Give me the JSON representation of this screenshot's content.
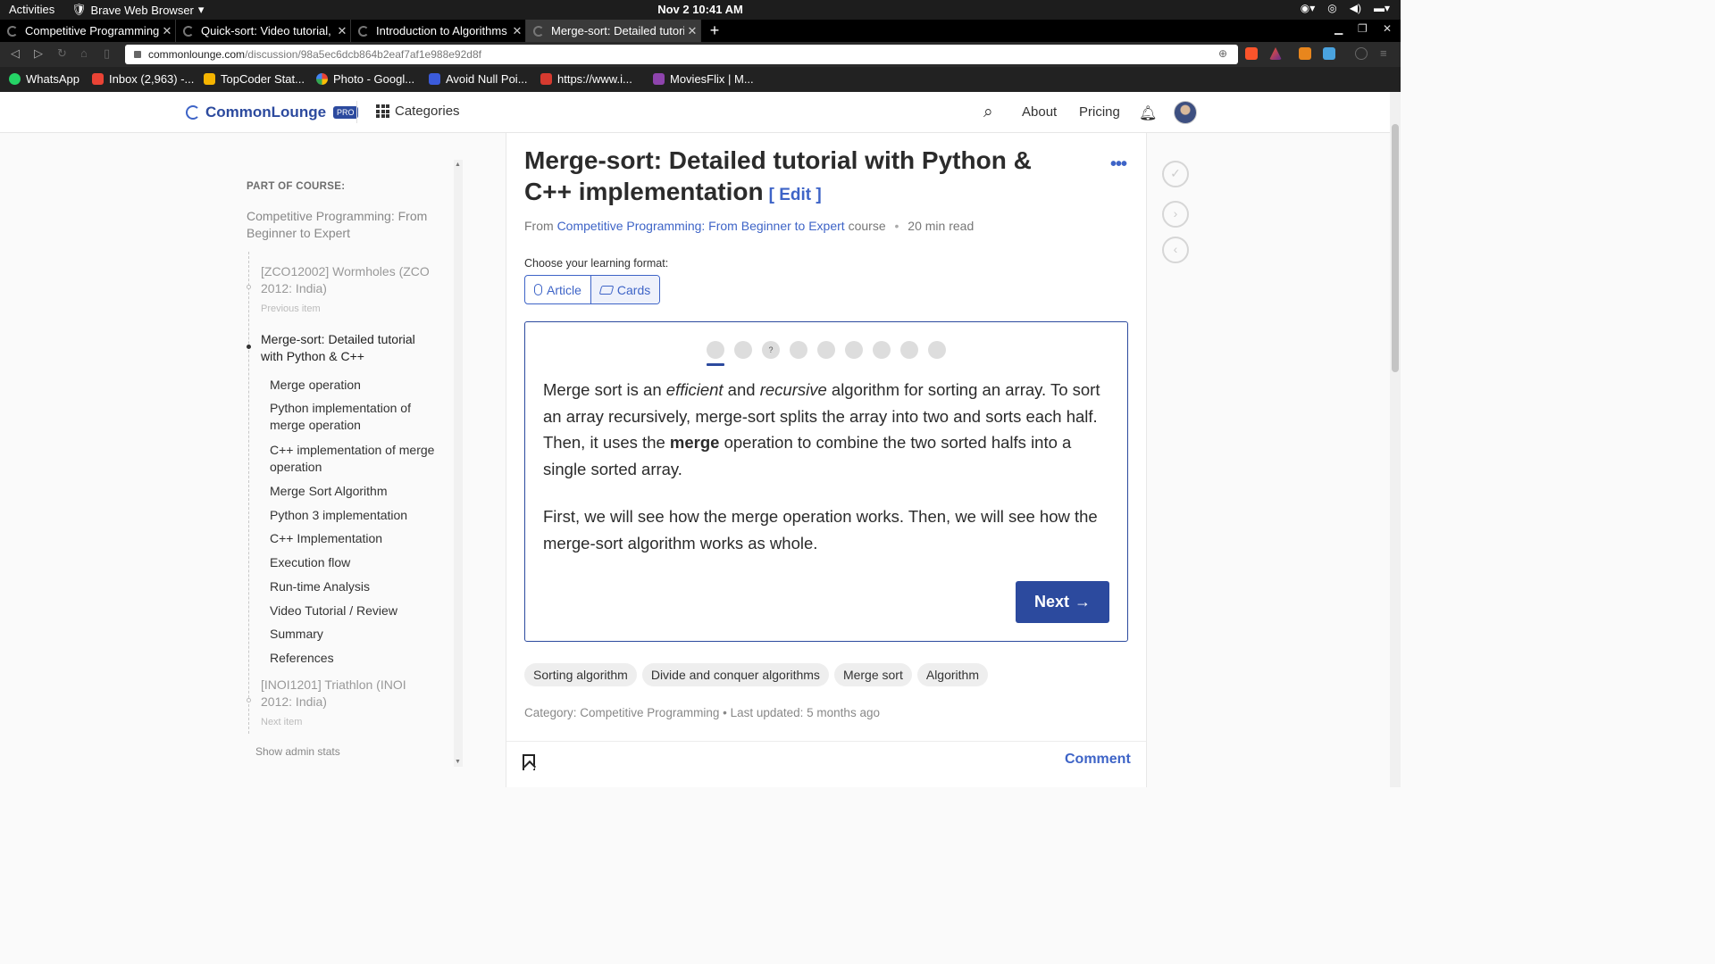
{
  "system_bar": {
    "activities": "Activities",
    "app_name": "Brave Web Browser",
    "clock": "Nov 2  10:41 AM"
  },
  "tabs": [
    {
      "title": "Competitive Programming",
      "active": false
    },
    {
      "title": "Quick-sort: Video tutorial,",
      "active": false
    },
    {
      "title": "Introduction to Algorithms",
      "active": false
    },
    {
      "title": "Merge-sort: Detailed tutori",
      "active": true
    }
  ],
  "address_bar": {
    "host": "commonlounge.com",
    "path": "/discussion/98a5ec6dcb864b2eaf7af1e988e92d8f"
  },
  "bookmarks": [
    {
      "label": "WhatsApp",
      "color": "#25d366"
    },
    {
      "label": "Inbox (2,963) -...",
      "color": "#ea4335"
    },
    {
      "label": "TopCoder Stat...",
      "color": "#f5b400"
    },
    {
      "label": "Photo - Googl...",
      "color": "#4285f4"
    },
    {
      "label": "Avoid Null Poi...",
      "color": "#3b5bdb"
    },
    {
      "label": "https://www.i...",
      "color": "#d63a2f"
    },
    {
      "label": "MoviesFlix | M...",
      "color": "#8e44ad"
    }
  ],
  "site_header": {
    "brand": "CommonLounge",
    "badge": "PRO",
    "categories": "Categories",
    "about": "About",
    "pricing": "Pricing"
  },
  "sidebar": {
    "label": "PART OF COURSE:",
    "course": "Competitive Programming: From Beginner to Expert",
    "previous": {
      "title": "[ZCO12002] Wormholes (ZCO 2012: India)",
      "sub": "Previous item"
    },
    "current": "Merge-sort: Detailed tutorial with Python & C++",
    "sections": [
      "Merge operation",
      "Python implementation of merge operation",
      "C++ implementation of merge operation",
      "Merge Sort Algorithm",
      "Python 3 implementation",
      "C++ Implementation",
      "Execution flow",
      "Run-time Analysis",
      "Video Tutorial / Review",
      "Summary",
      "References"
    ],
    "next": {
      "title": "[INOI1201] Triathlon (INOI 2012: India)",
      "sub": "Next item"
    },
    "admin": "Show admin stats"
  },
  "article": {
    "title": "Merge-sort: Detailed tutorial with Python & C++ implementation",
    "edit": "[ Edit ]",
    "from": "From",
    "course_link": "Competitive Programming: From Beginner to Expert",
    "course_word": "course",
    "read_time": "20 min read",
    "format_label": "Choose your learning format:",
    "format_article": "Article",
    "format_cards": "Cards",
    "progress_marker": "?",
    "para1": {
      "a": "Merge sort is an ",
      "b": "efficient",
      "c": " and ",
      "d": "recursive",
      "e": " algorithm for sorting an array. To sort an array recursively, merge-sort splits the array into two and sorts each half. Then, it uses the ",
      "f": "merge",
      "g": " operation to combine the two sorted halfs into a single sorted array."
    },
    "para2": "First, we will see how the merge operation works. Then, we will see how the merge-sort algorithm works as whole.",
    "next_label": "Next",
    "next_arrow": "→",
    "tags": [
      "Sorting algorithm",
      "Divide and conquer algorithms",
      "Merge sort",
      "Algorithm"
    ],
    "category_line": "Category: Competitive Programming",
    "updated": "Last updated: 5 months ago",
    "comment": "Comment"
  }
}
